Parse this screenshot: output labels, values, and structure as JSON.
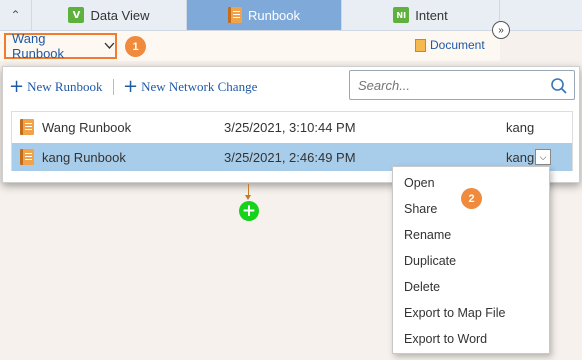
{
  "tabs": [
    {
      "label": "Data View",
      "icon": "data-view-icon",
      "icon_glyph": "V"
    },
    {
      "label": "Runbook",
      "icon": "runbook-icon"
    },
    {
      "label": "Intent",
      "icon": "intent-icon",
      "icon_glyph": "NI"
    }
  ],
  "active_tab": "Runbook",
  "selector": {
    "label": "Wang Runbook",
    "badge": "1"
  },
  "document_link": "Document",
  "toolbar": {
    "new_runbook": "New Runbook",
    "new_network_change": "New Network Change"
  },
  "search": {
    "placeholder": "Search...",
    "value": ""
  },
  "runbooks": [
    {
      "name": "Wang Runbook",
      "date": "3/25/2021, 3:10:44 PM",
      "owner": "kang"
    },
    {
      "name": "kang Runbook",
      "date": "3/25/2021, 2:46:49 PM",
      "owner": "kang",
      "selected": true
    }
  ],
  "context_menu": {
    "badge": "2",
    "items": [
      "Open",
      "Share",
      "Rename",
      "Duplicate",
      "Delete",
      "Export to Map File",
      "Export to Word"
    ]
  },
  "colors": {
    "accent": "#7fa9d9",
    "highlight_border": "#f07d2f",
    "badge": "#f08a3c",
    "selected_row": "#a8cdea",
    "link": "#1f5aa6",
    "add_node": "#17d21a"
  }
}
